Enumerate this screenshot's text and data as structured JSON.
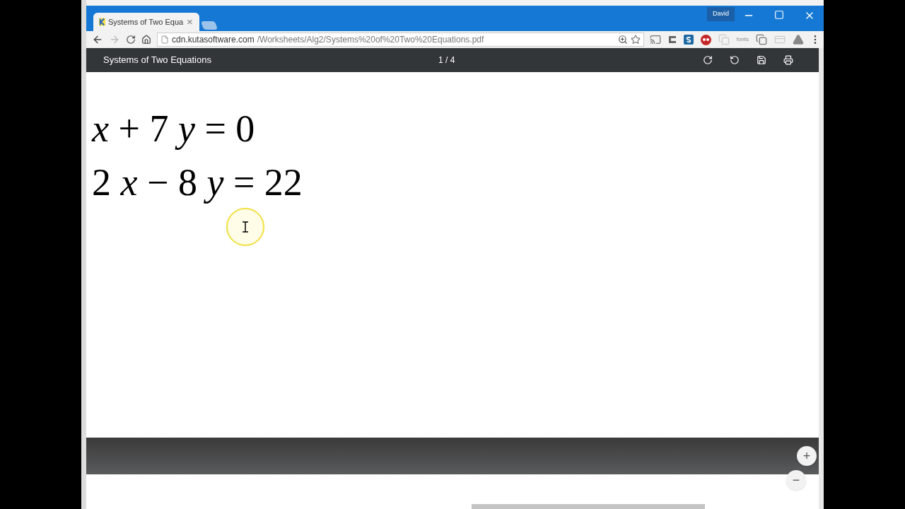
{
  "window": {
    "profile": "David"
  },
  "tabs": [
    {
      "title": "Systems of Two Equa",
      "selected": true
    }
  ],
  "address": {
    "host": "cdn.kutasoftware.com",
    "path": "/Worksheets/Alg2/Systems%20of%20Two%20Equations.pdf"
  },
  "extensions": [
    {
      "kind": "cast"
    },
    {
      "kind": "c"
    },
    {
      "kind": "s"
    },
    {
      "kind": "m"
    },
    {
      "kind": "window"
    },
    {
      "kind": "text",
      "label": "fonts"
    },
    {
      "kind": "copy"
    },
    {
      "kind": "card"
    },
    {
      "kind": "drive"
    }
  ],
  "pdf_toolbar": {
    "title": "Systems of Two Equations",
    "page": "1 / 4"
  },
  "equations": [
    "*x* + 7 *y* = 0",
    "2 *x* − 8 *y* = 22"
  ],
  "zoom_buttons": [
    "+",
    "−"
  ]
}
